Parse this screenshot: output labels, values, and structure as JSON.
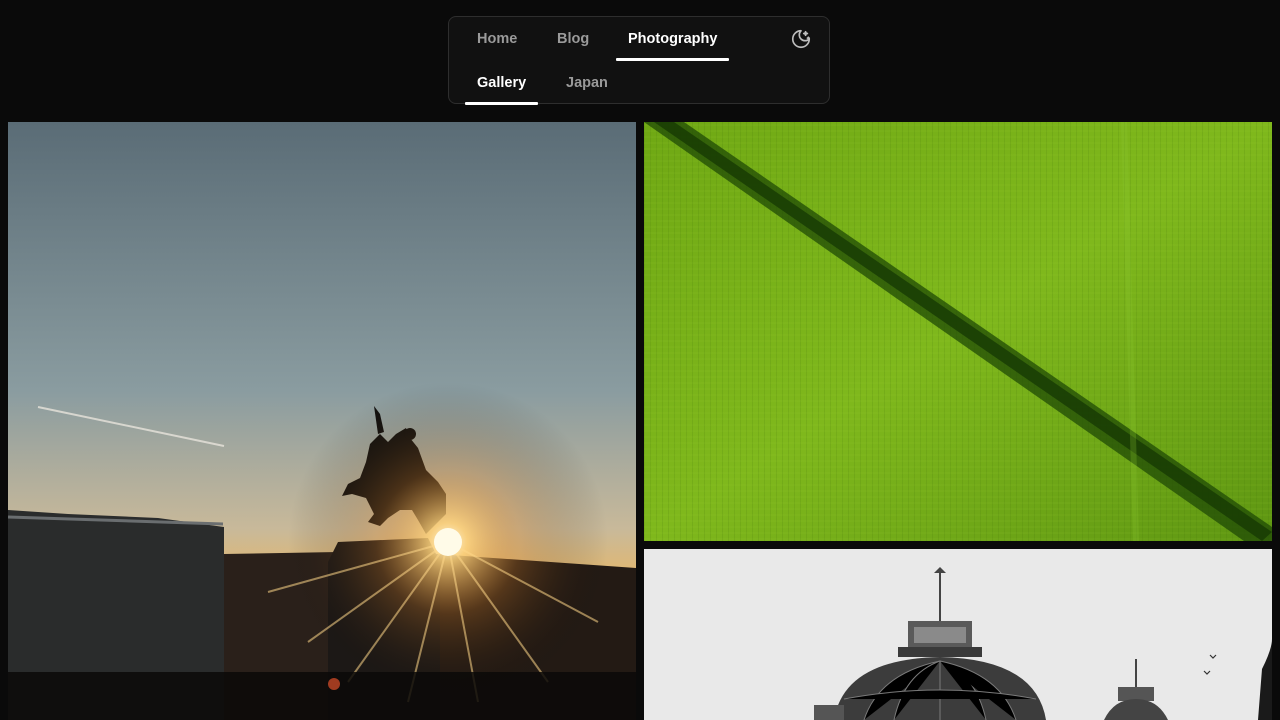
{
  "nav": {
    "primary_tabs": [
      {
        "label": "Home",
        "active": false
      },
      {
        "label": "Blog",
        "active": false
      },
      {
        "label": "Photography",
        "active": true
      }
    ],
    "secondary_tabs": [
      {
        "label": "Gallery",
        "active": true
      },
      {
        "label": "Japan",
        "active": false
      }
    ],
    "theme_toggle_icon": "moon-stars-icon"
  },
  "gallery": {
    "photos": [
      {
        "subject": "equestrian-statue-at-sunset"
      },
      {
        "subject": "green-leaf-macro"
      },
      {
        "subject": "glass-dome-greenhouse-black-and-white"
      }
    ]
  },
  "colors": {
    "background": "#0a0a0a",
    "nav_background": "#111111",
    "nav_border": "#2e2e2e",
    "tab_active": "#ffffff",
    "tab_inactive": "#9a9a9a"
  }
}
